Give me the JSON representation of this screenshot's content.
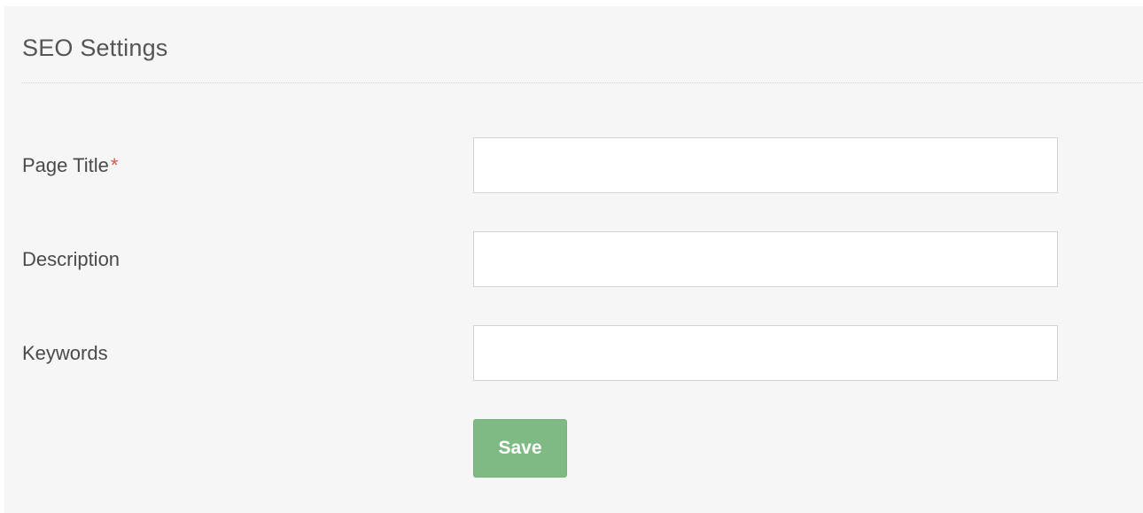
{
  "panel": {
    "title": "SEO Settings"
  },
  "form": {
    "fields": [
      {
        "label": "Page Title",
        "required_marker": "*",
        "value": "",
        "placeholder": ""
      },
      {
        "label": "Description",
        "value": "",
        "placeholder": ""
      },
      {
        "label": "Keywords",
        "value": "",
        "placeholder": ""
      }
    ],
    "save_label": "Save"
  },
  "colors": {
    "panel_background": "#f6f6f6",
    "required_marker": "#d9534f",
    "save_button": "#7fba84"
  }
}
